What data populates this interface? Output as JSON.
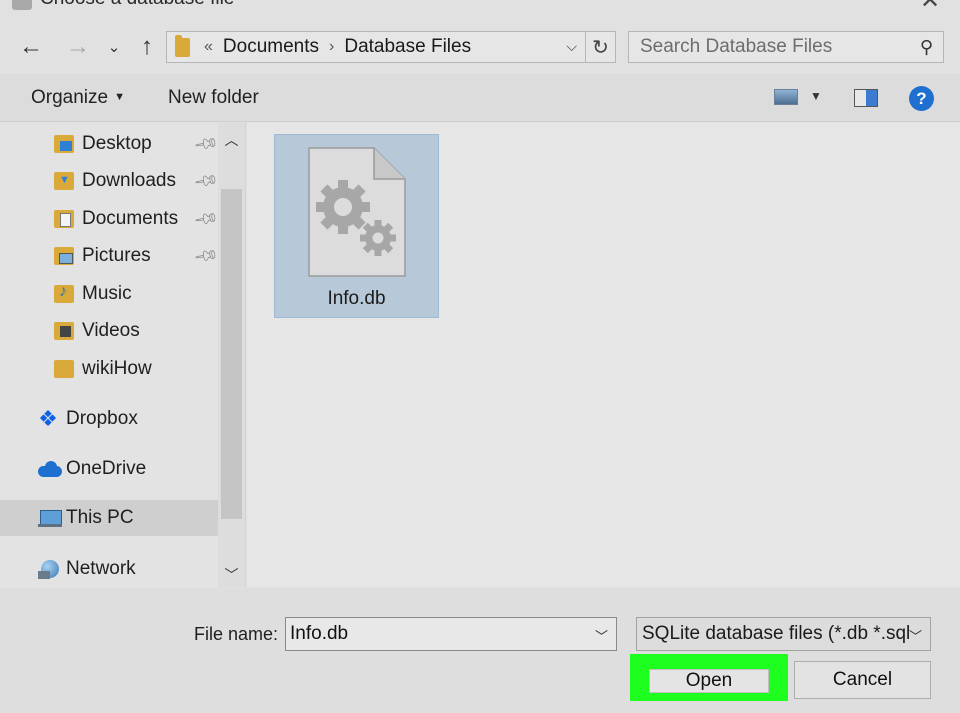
{
  "window": {
    "title": "Choose a database file"
  },
  "address_bar": {
    "overflow_glyph": "«",
    "separator": "›",
    "crumbs": [
      "Documents",
      "Database Files"
    ]
  },
  "search": {
    "placeholder": "Search Database Files"
  },
  "toolbar": {
    "organize_label": "Organize",
    "new_folder_label": "New folder",
    "help_glyph": "?"
  },
  "nav": {
    "quick_access": [
      {
        "label": "Desktop",
        "pinned": true,
        "icon": "desktop-folder-icon"
      },
      {
        "label": "Downloads",
        "pinned": true,
        "icon": "downloads-folder-icon"
      },
      {
        "label": "Documents",
        "pinned": true,
        "icon": "documents-folder-icon"
      },
      {
        "label": "Pictures",
        "pinned": true,
        "icon": "pictures-folder-icon"
      },
      {
        "label": "Music",
        "pinned": false,
        "icon": "music-folder-icon"
      },
      {
        "label": "Videos",
        "pinned": false,
        "icon": "videos-folder-icon"
      },
      {
        "label": "wikiHow",
        "pinned": false,
        "icon": "folder-icon"
      }
    ],
    "locations": [
      {
        "label": "Dropbox",
        "icon": "dropbox-icon"
      },
      {
        "label": "OneDrive",
        "icon": "onedrive-cloud-icon"
      },
      {
        "label": "This PC",
        "icon": "this-pc-icon",
        "selected": true
      },
      {
        "label": "Network",
        "icon": "network-icon"
      }
    ]
  },
  "files": [
    {
      "name": "Info.db",
      "icon": "database-file-gears-icon",
      "selected": true
    }
  ],
  "bottom": {
    "file_name_label": "File name:",
    "file_name_value": "Info.db",
    "file_type": "SQLite database files (*.db *.sql",
    "open_label": "Open",
    "cancel_label": "Cancel",
    "highlight_color": "#1fff1f"
  }
}
